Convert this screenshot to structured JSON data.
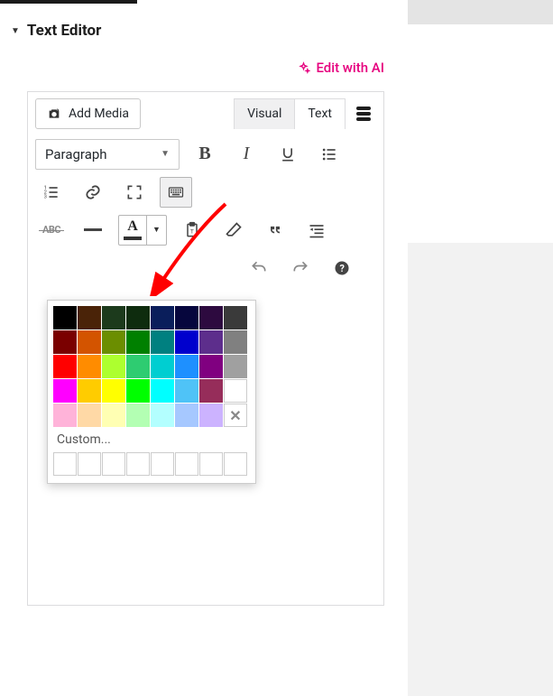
{
  "section": {
    "title": "Text Editor"
  },
  "ai": {
    "label": "Edit with AI"
  },
  "toolbar": {
    "add_media": "Add Media",
    "tabs": {
      "visual": "Visual",
      "text": "Text"
    },
    "format": "Paragraph",
    "bold": "B",
    "italic": "I",
    "strike": "ABC",
    "text_color_glyph": "A"
  },
  "picker": {
    "custom_label": "Custom...",
    "rows": [
      [
        "#000000",
        "#4a2308",
        "#1c3a1c",
        "#0e2c0e",
        "#0a1e5b",
        "#06063d",
        "#2d0a3f",
        "#3a3a3a"
      ],
      [
        "#7a0000",
        "#d35400",
        "#6b8e00",
        "#008000",
        "#008080",
        "#0000cd",
        "#5d2e8c",
        "#808080"
      ],
      [
        "#ff0000",
        "#ff8c00",
        "#adff2f",
        "#2ecc71",
        "#00ced1",
        "#1e90ff",
        "#800080",
        "#a0a0a0"
      ],
      [
        "#ff00ff",
        "#ffcc00",
        "#ffff00",
        "#00ff00",
        "#00ffff",
        "#4fc3f7",
        "#962d5a",
        "#ffffff"
      ],
      [
        "#ffb3d9",
        "#ffd9a6",
        "#ffffb3",
        "#b3ffb3",
        "#b3ffff",
        "#a6c8ff",
        "#ccb3ff",
        "NOCOLOR"
      ]
    ],
    "recent_count": 8
  },
  "colors": {
    "accent": "#e6007e"
  }
}
